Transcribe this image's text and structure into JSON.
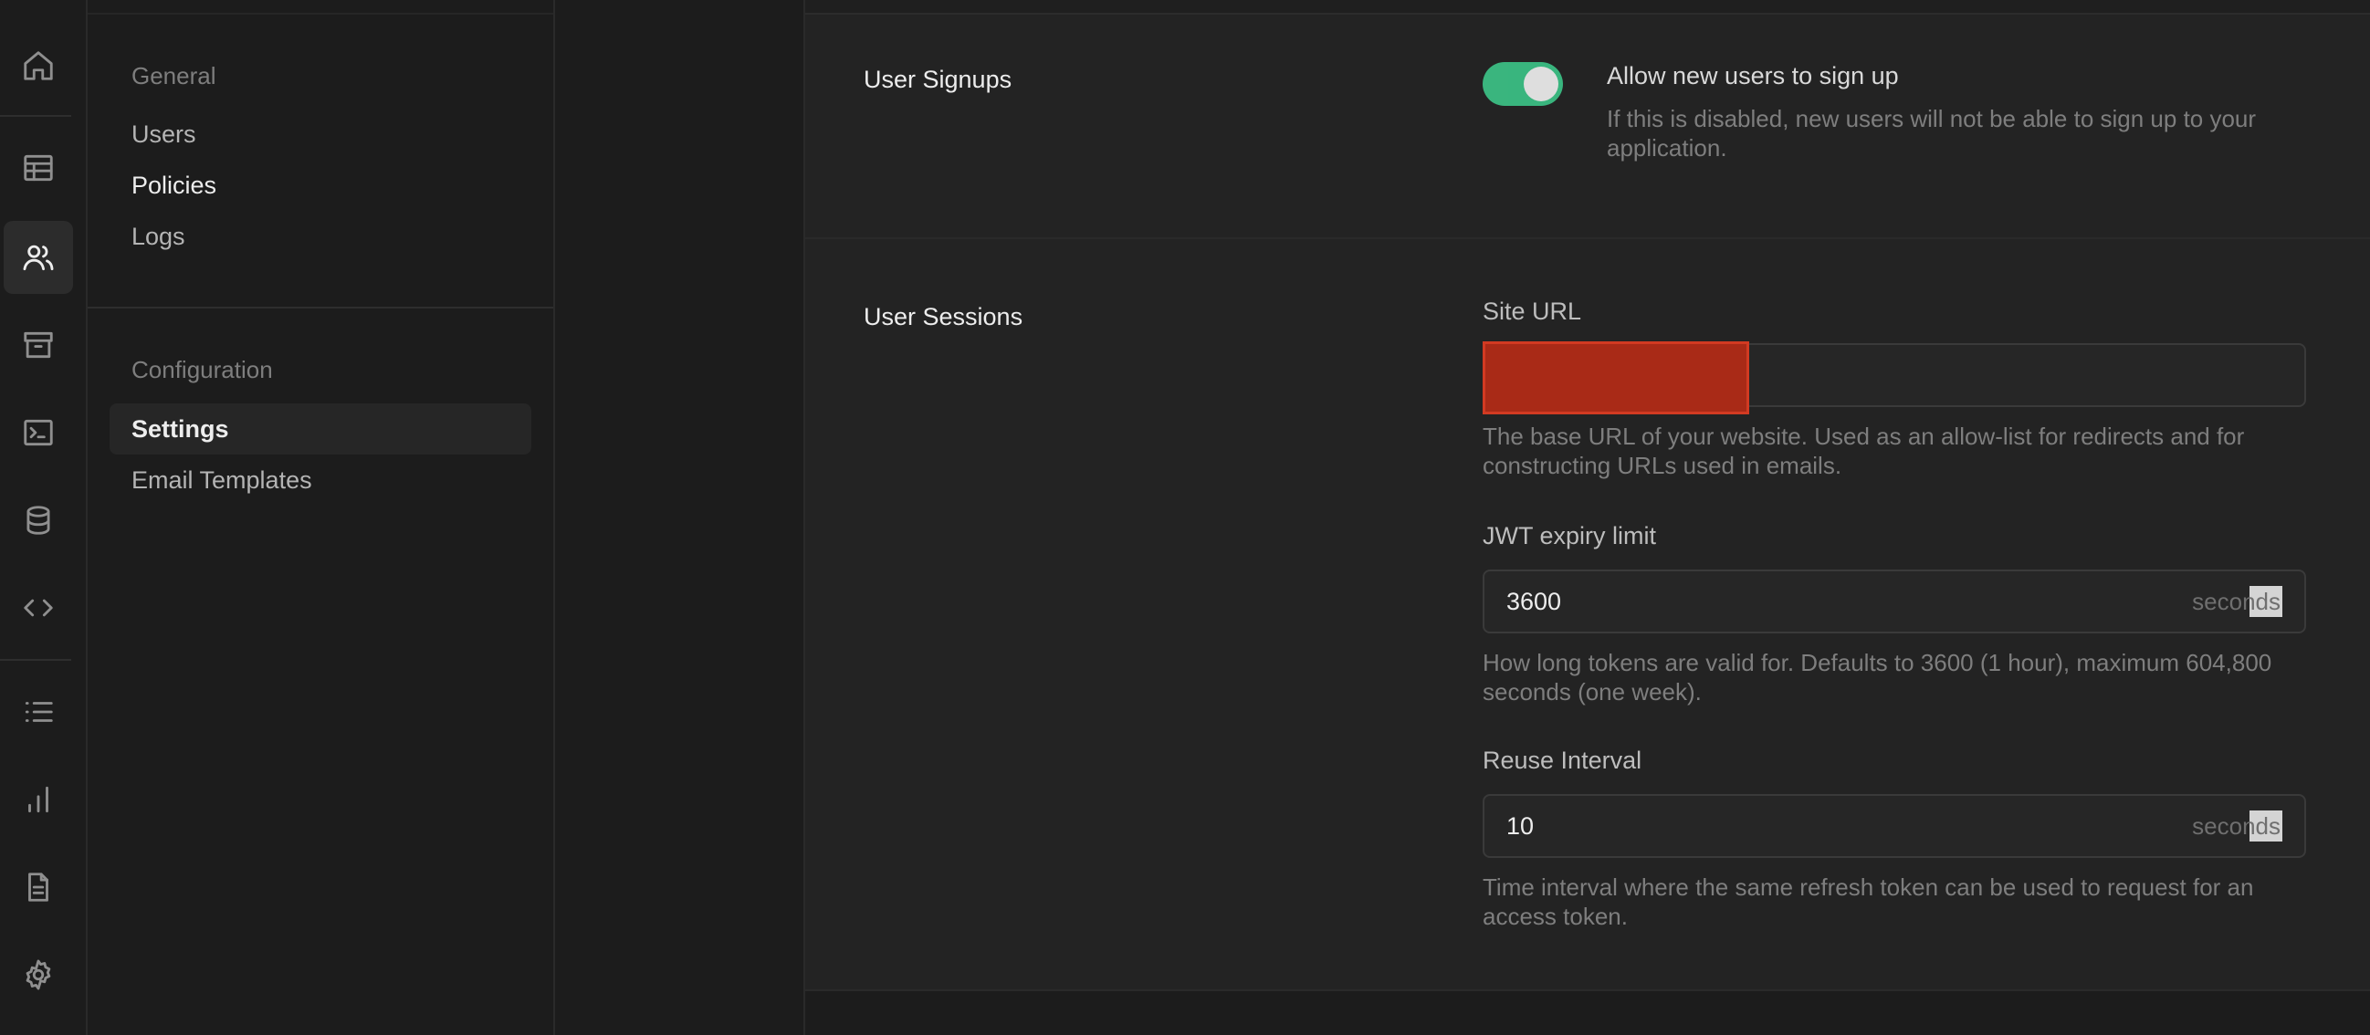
{
  "rail": {
    "items": [
      {
        "name": "home-icon"
      },
      {
        "name": "table-editor-icon"
      },
      {
        "name": "users-icon",
        "active": true
      },
      {
        "name": "archive-icon"
      },
      {
        "name": "terminal-icon"
      },
      {
        "name": "database-icon"
      },
      {
        "name": "code-icon"
      },
      {
        "name": "list-icon"
      },
      {
        "name": "bar-chart-icon"
      },
      {
        "name": "document-icon"
      },
      {
        "name": "gear-icon"
      }
    ]
  },
  "subnav": {
    "general_heading": "General",
    "general_items": [
      "Users",
      "Policies",
      "Logs"
    ],
    "config_heading": "Configuration",
    "config_items": [
      "Settings",
      "Email Templates"
    ],
    "active_item": "Settings"
  },
  "signups": {
    "title": "User Signups",
    "toggle_on": true,
    "toggle_label": "Allow new users to sign up",
    "toggle_description": "If this is disabled, new users will not be able to sign up to your application."
  },
  "sessions": {
    "title": "User Sessions",
    "site_url": {
      "label": "Site URL",
      "value": "",
      "redacted": true,
      "help": "The base URL of your website. Used as an allow-list for redirects and for constructing URLs used in emails."
    },
    "jwt_expiry": {
      "label": "JWT expiry limit",
      "value": "3600",
      "unit": "seconds",
      "help": "How long tokens are valid for. Defaults to 3600 (1 hour), maximum 604,800 seconds (one week)."
    },
    "reuse_interval": {
      "label": "Reuse Interval",
      "value": "10",
      "unit": "seconds",
      "help": "Time interval where the same refresh token can be used to request for an access token."
    }
  },
  "colors": {
    "accent_green": "#3ecf8e",
    "redaction_red": "#a92a17"
  }
}
